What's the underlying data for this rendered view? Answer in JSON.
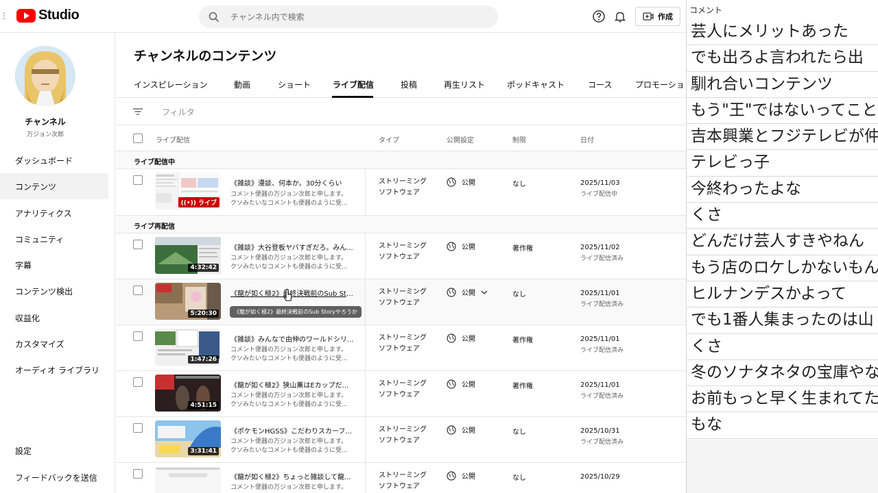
{
  "header": {
    "logo_text": "Studio",
    "search_placeholder": "チャンネル内で検索",
    "create_label": "作成"
  },
  "sidebar": {
    "channel_name": "チャンネル",
    "channel_handle": "万ジョン次郎",
    "items": [
      {
        "label": "ダッシュボード"
      },
      {
        "label": "コンテンツ",
        "active": true
      },
      {
        "label": "アナリティクス"
      },
      {
        "label": "コミュニティ"
      },
      {
        "label": "字幕"
      },
      {
        "label": "コンテンツ検出"
      },
      {
        "label": "収益化"
      },
      {
        "label": "カスタマイズ"
      },
      {
        "label": "オーディオ ライブラリ"
      }
    ],
    "bottom_items": [
      {
        "label": "設定"
      },
      {
        "label": "フィードバックを送信"
      }
    ]
  },
  "main": {
    "title": "チャンネルのコンテンツ",
    "tabs": [
      {
        "label": "インスピレーション"
      },
      {
        "label": "動画"
      },
      {
        "label": "ショート"
      },
      {
        "label": "ライブ配信",
        "active": true
      },
      {
        "label": "投稿"
      },
      {
        "label": "再生リスト"
      },
      {
        "label": "ポッドキャスト"
      },
      {
        "label": "コース"
      },
      {
        "label": "プロモーショ"
      }
    ],
    "filter_label": "フィルタ",
    "columns": {
      "video": "ライブ配信",
      "type": "タイプ",
      "visibility": "公開設定",
      "restrictions": "制限",
      "date": "日付"
    },
    "section_live": "ライブ配信中",
    "section_replay": "ライブ再配信",
    "live_row": {
      "title": "《雑談》漫談、何本か。30分くらい",
      "desc1": "コメント便器の万ジョン次郎と申します。",
      "desc2": "クソみたいなコメントも便器のように受...",
      "badge": "ライブ",
      "type1": "ストリーミング",
      "type2": "ソフトウェア",
      "visibility": "公開",
      "restrictions": "なし",
      "date": "2025/11/03",
      "date_sub": "ライブ配信中"
    },
    "rows": [
      {
        "title": "《雑談》大谷登板ヤバすぎだろ。みん...",
        "desc1": "コメント便器の万ジョン次郎と申します。",
        "desc2": "クソみたいなコメントも便器のように受...",
        "duration": "4:32:42",
        "type1": "ストリーミング",
        "type2": "ソフトウェア",
        "visibility": "公開",
        "restrictions": "著作権",
        "date": "2025/11/02",
        "date_sub": "ライブ配信済み"
      },
      {
        "title": "《龍が如く極2》最終決戦前のSub Sto...",
        "desc1": "コメント便器の万ジョン次郎と申します。",
        "desc2": "クソみたいなコメントも便器のように受...",
        "duration": "5:20:30",
        "type1": "ストリーミング",
        "type2": "ソフトウェア",
        "visibility": "公開",
        "restrictions": "なし",
        "date": "2025/11/01",
        "date_sub": "ライブ配信済み",
        "tooltip": "《龍が如く極2》最終決戦前のSub Storyやろうか"
      },
      {
        "title": "《雑談》みんなで由伸のワールドシリ...",
        "desc1": "コメント便器の万ジョン次郎と申します。",
        "desc2": "クソみたいなコメントも便器のように受...",
        "duration": "1:47:26",
        "type1": "ストリーミング",
        "type2": "ソフトウェア",
        "visibility": "公開",
        "restrictions": "著作権",
        "date": "2025/11/01",
        "date_sub": "ライブ配信済み"
      },
      {
        "title": "《龍が如く極2》狭山薫はEカップだ...",
        "desc1": "コメント便器の万ジョン次郎と申します。",
        "desc2": "クソみたいなコメントも便器のように受...",
        "duration": "4:51:15",
        "type1": "ストリーミング",
        "type2": "ソフトウェア",
        "visibility": "公開",
        "restrictions": "著作権",
        "date": "2025/11/01",
        "date_sub": "ライブ配信済み"
      },
      {
        "title": "《ポケモンHGSS》こだわりスカーフ...",
        "desc1": "コメント便器の万ジョン次郎と申します。",
        "desc2": "クソみたいなコメントも便器のように受...",
        "duration": "3:31:41",
        "type1": "ストリーミング",
        "type2": "ソフトウェア",
        "visibility": "公開",
        "restrictions": "なし",
        "date": "2025/10/31",
        "date_sub": "ライブ配信済み"
      },
      {
        "title": "《龍が如く極2》ちょっと雑談して龍...",
        "desc1": "コメント便器の万ジョン次郎と申します。",
        "desc2": "",
        "duration": "",
        "type1": "ストリーミング",
        "type2": "ソフトウェア",
        "visibility": "公開",
        "restrictions": "なし",
        "date": "2025/10/29",
        "date_sub": ""
      }
    ]
  },
  "comments": {
    "title": "コメント",
    "items": [
      "芸人にメリットあった",
      "でも出ろよ言われたら出",
      "馴れ合いコンテンツ",
      "もう\"王\"ではないってこと",
      "吉本興業とフジテレビが仲",
      "テレビっ子",
      "今終わったよな",
      "くさ",
      "どんだけ芸人すきやねん",
      "もう店のロケしかないもん",
      "ヒルナンデスかよって",
      "でも1番人集まったのは山",
      "くさ",
      "冬のソナタネタの宝庫やな",
      "お前もっと早く生まれてた",
      "もな"
    ]
  },
  "colors": {
    "accent": "#ff0000",
    "live_badge": "#cc0000",
    "text": "#0f0f0f",
    "subtext": "#606060"
  }
}
